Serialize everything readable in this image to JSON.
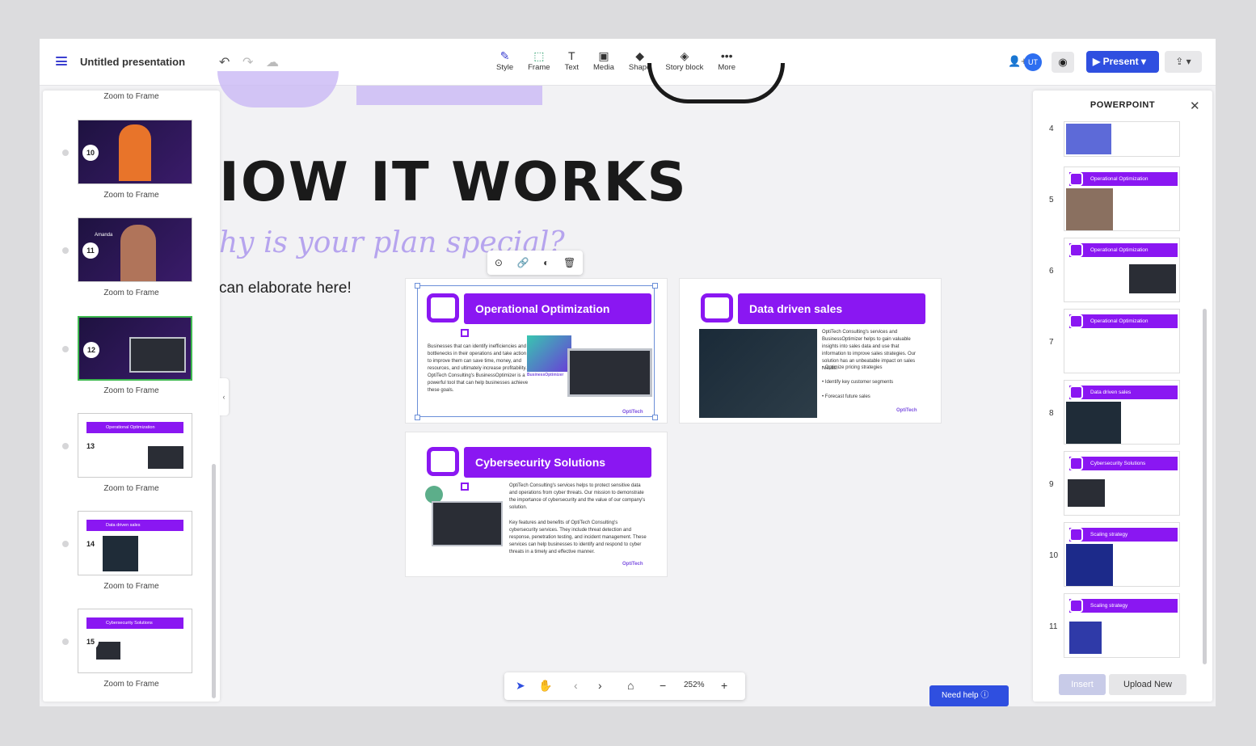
{
  "toolbar": {
    "title": "Untitled presentation",
    "tools": [
      {
        "label": "Style",
        "icon": "pen-icon"
      },
      {
        "label": "Frame",
        "icon": "frame-icon"
      },
      {
        "label": "Text",
        "icon": "text-icon"
      },
      {
        "label": "Media",
        "icon": "media-icon"
      },
      {
        "label": "Shape",
        "icon": "shape-icon"
      },
      {
        "label": "Story block",
        "icon": "layers-icon"
      },
      {
        "label": "More",
        "icon": "more-icon"
      }
    ],
    "avatar": "UT",
    "present": "Present"
  },
  "left_panel": {
    "items": [
      {
        "num": "",
        "caption": "Zoom to Frame"
      },
      {
        "num": "10",
        "caption": "Zoom to Frame"
      },
      {
        "num": "11",
        "caption": "Zoom to Frame"
      },
      {
        "num": "12",
        "caption": "Zoom to Frame"
      },
      {
        "num": "13",
        "caption": "Zoom to Frame",
        "bar": "Operational Optimization"
      },
      {
        "num": "14",
        "caption": "Zoom to Frame",
        "bar": "Data driven sales"
      },
      {
        "num": "15",
        "caption": "Zoom to Frame",
        "bar": "Cybersecurity Solutions"
      }
    ],
    "thumb_10_name": "Amanda"
  },
  "canvas": {
    "headline": "IOW IT WORKS",
    "subhead": "hy is your plan special?",
    "elaborate": "can elaborate here!",
    "slides": [
      {
        "title": "Operational Optimization",
        "body": "Businesses that can identify inefficiencies and bottlenecks in their operations and take action to improve them can save time, money, and resources, and ultimately increase profitability. OptiTech Consulting's BusinessOptimizer is a powerful tool that can help businesses achieve these goals.",
        "tag": "BusinessOptimizer"
      },
      {
        "title": "Data driven sales",
        "body": "OptiTech Consulting's services and BusinessOptimizer helps to gain valuable insights into sales data and use that information to improve sales strategies. Our solution has an unbeatable impact on sales results.",
        "bullets": [
          "Optimize pricing strategies",
          "Identify key customer segments",
          "Forecast future sales"
        ]
      },
      {
        "title": "Cybersecurity Solutions",
        "body": "OptiTech Consulting's services helps to protect sensitive data and operations from cyber threats. Our mission to demonstrate the importance of cybersecurity and the value of our company's solution.",
        "body2": "Key features and benefits of OptiTech Consulting's cybersecurity services. They include threat detection and response, penetration testing, and incident management. These services can help businesses to identify and respond to cyber threats in a timely and effective manner."
      }
    ],
    "logo": "OptiTech"
  },
  "right_panel": {
    "title": "POWERPOINT",
    "rows": [
      {
        "num": "4",
        "bar": ""
      },
      {
        "num": "5",
        "bar": "Operational Optimization"
      },
      {
        "num": "6",
        "bar": "Operational Optimization"
      },
      {
        "num": "7",
        "bar": "Operational Optimization"
      },
      {
        "num": "8",
        "bar": "Data driven sales"
      },
      {
        "num": "9",
        "bar": "Cybersecurity Solutions"
      },
      {
        "num": "10",
        "bar": "Scaling strategy"
      },
      {
        "num": "11",
        "bar": "Scaling strategy"
      }
    ],
    "insert": "Insert",
    "upload": "Upload New"
  },
  "zoom": {
    "level": "252%"
  },
  "help": "Need help"
}
